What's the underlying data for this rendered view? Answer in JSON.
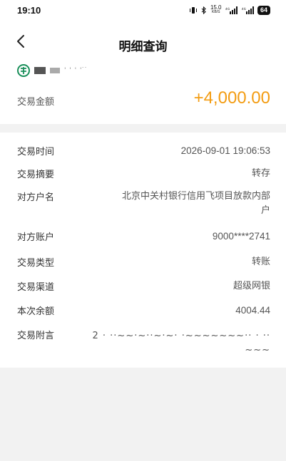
{
  "status_bar": {
    "time": "19:10",
    "net_speed_top": "15.0",
    "net_speed_bottom": "KB/S",
    "signal1_tag": "⁴⁶",
    "signal2_tag": "⁴⁶",
    "battery": "64"
  },
  "header": {
    "title": "明细查询"
  },
  "account": {
    "masked_text": "' ' ' ' ̇ ̇"
  },
  "amount": {
    "label": "交易金额",
    "value": "+4,000.00",
    "color": "#f39c12"
  },
  "details": [
    {
      "label": "交易时间",
      "value": "2026-09-01 19:06:53"
    },
    {
      "label": "交易摘要",
      "value": "转存"
    },
    {
      "label": "对方户名",
      "value": "北京中关村银行信用飞项目放款内部户"
    },
    {
      "label": "对方账户",
      "value": "9000****2741"
    },
    {
      "label": "交易类型",
      "value": "转账"
    },
    {
      "label": "交易渠道",
      "value": "超级网银"
    },
    {
      "label": "本次余额",
      "value": "4004.44"
    },
    {
      "label": "交易附言",
      "value": "2 · ··~~·~··~·~· ·~~~~~~~·· · ··",
      "value_line2": "~~~"
    }
  ],
  "colors": {
    "accent": "#f39c12",
    "bank_logo": "#1a8f5a",
    "background": "#f2f2f2"
  },
  "icons": {
    "back": "chevron-left-icon",
    "logo": "abc-bank-logo-icon"
  }
}
